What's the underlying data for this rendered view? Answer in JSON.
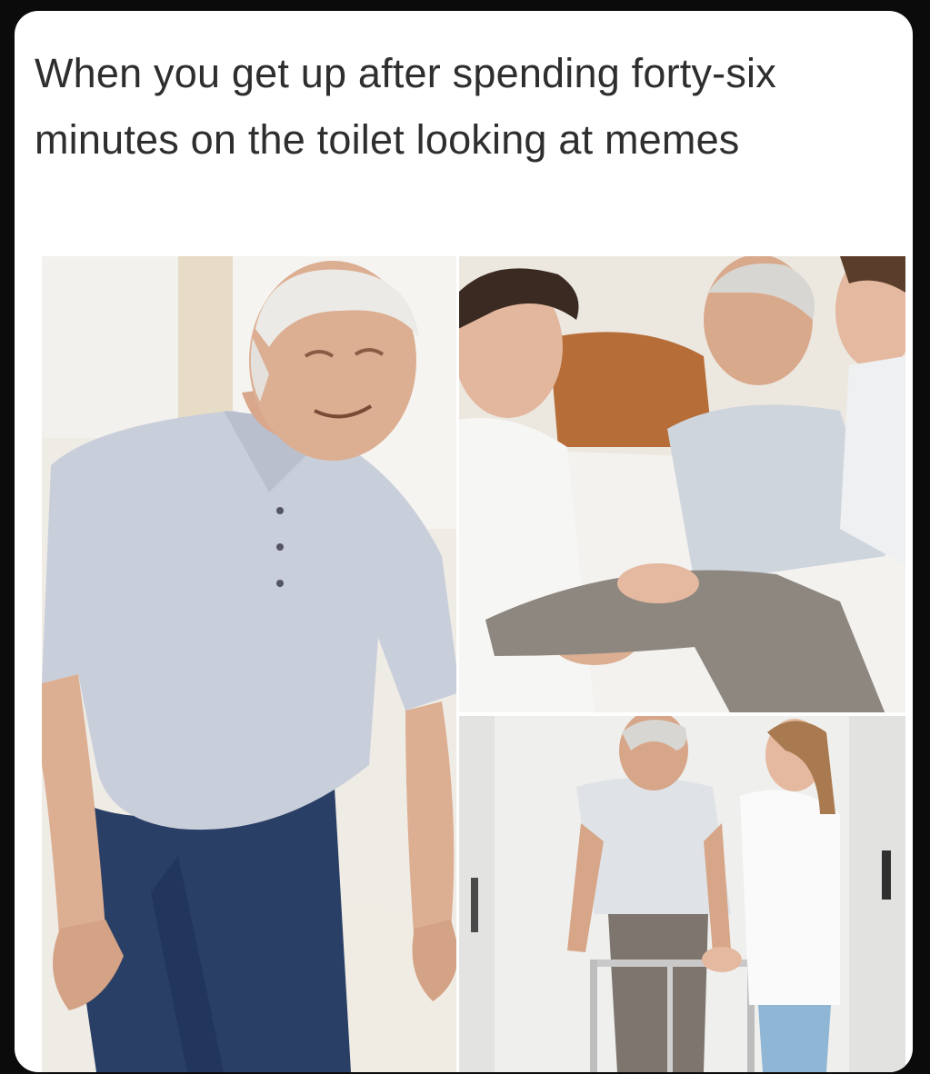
{
  "meme": {
    "caption": "When you get up after spending forty-six minutes on the toilet looking at memes"
  },
  "panels": [
    {
      "icon": "elderly-man-standing-up-photo"
    },
    {
      "icon": "caregivers-helping-elderly-man-photo"
    },
    {
      "icon": "elderly-man-with-walker-photo"
    }
  ],
  "colors": {
    "page_background": "#0b0b0b",
    "card_background": "#ffffff",
    "caption_text": "#2e2e2e",
    "polo_shirt": "#c9cedb",
    "jeans": "#2a3f66",
    "skin": "#dcae92",
    "white_hair": "#eceae6",
    "headboard": "#b66d37"
  }
}
